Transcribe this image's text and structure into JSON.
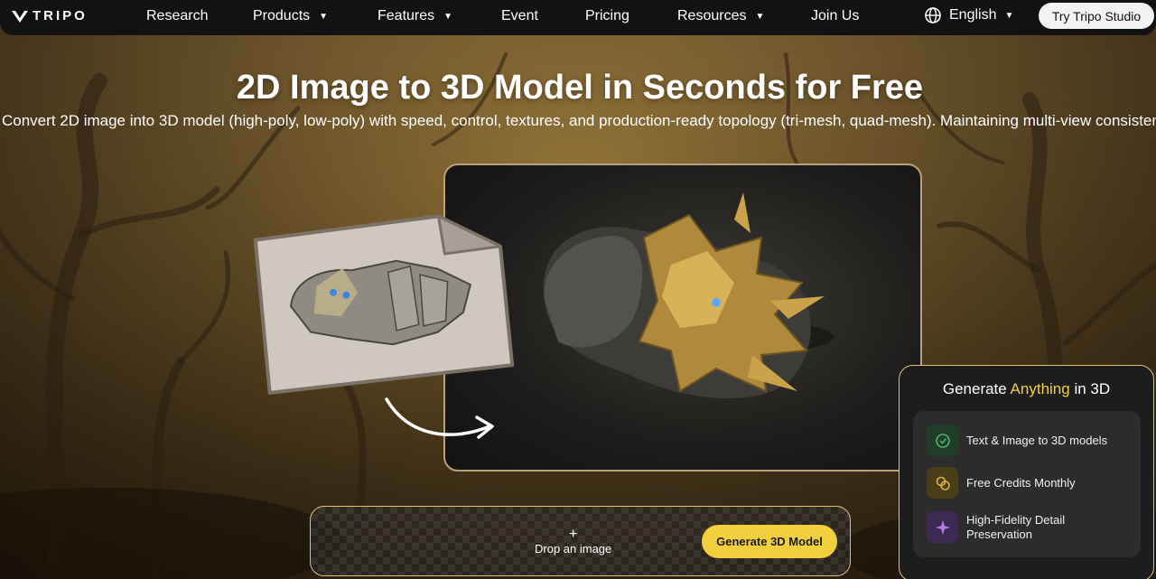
{
  "nav": {
    "logo_text": "TRIPO",
    "items": [
      {
        "label": "Research"
      },
      {
        "label": "Products",
        "dropdown": true
      },
      {
        "label": "Features",
        "dropdown": true
      },
      {
        "label": "Event"
      },
      {
        "label": "Pricing"
      },
      {
        "label": "Resources",
        "dropdown": true
      },
      {
        "label": "Join Us"
      }
    ],
    "language": "English",
    "cta": "Try Tripo Studio"
  },
  "hero": {
    "title": "2D Image to 3D Model in Seconds for Free",
    "subtitle": "Convert 2D image into 3D model (high-poly, low-poly) with speed, control, textures, and production-ready topology (tri-mesh, quad-mesh). Maintaining multi-view consistency"
  },
  "upload": {
    "plus": "+",
    "drop_label": "Drop an image",
    "generate_button": "Generate 3D Model"
  },
  "side_card": {
    "title_prefix": "Generate",
    "title_accent": "Anything",
    "title_suffix": "in 3D",
    "features": [
      {
        "label": "Text & Image to 3D models",
        "icon": "cube-sparkle-icon",
        "icon_color": "#4caf6a"
      },
      {
        "label": "Free Credits Monthly",
        "icon": "coins-icon",
        "icon_color": "#d9b23c"
      },
      {
        "label": "High-Fidelity Detail Preservation",
        "icon": "sparkle-icon",
        "icon_color": "#b77be8"
      }
    ]
  },
  "colors": {
    "accent": "#f2cf3d",
    "nav_bg": "#121212",
    "card_border": "#d9c27a"
  }
}
